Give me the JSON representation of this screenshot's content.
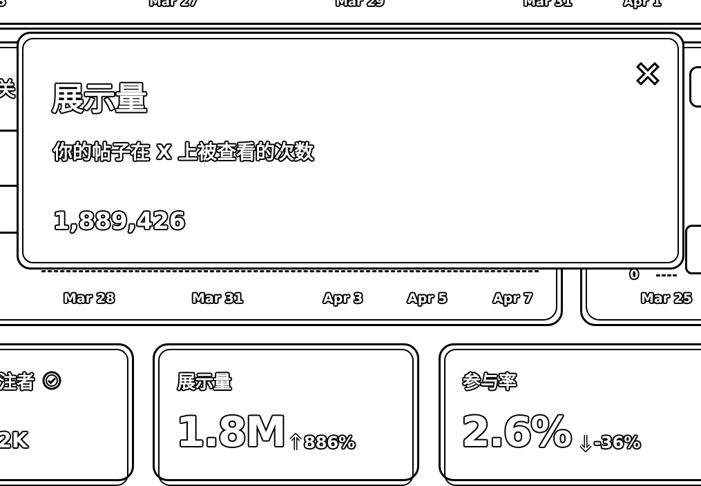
{
  "top_axis": {
    "labels": [
      "5",
      "Mar 27",
      "Mar 29",
      "Mar 31",
      "Apr 1"
    ]
  },
  "left_chart": {
    "x_labels": [
      "Mar 28",
      "Mar 31",
      "Apr 3",
      "Apr 5",
      "Apr 7"
    ]
  },
  "right_chart": {
    "y_zero": "0",
    "x_labels": [
      "Mar 25"
    ]
  },
  "left_fragment": "关",
  "tooltip": {
    "title": "展示量",
    "description": "你的帖子在 X 上被查看的次数",
    "value": "1,889,426",
    "close_icon": "close-icon"
  },
  "cards": {
    "followers": {
      "label": "注者",
      "value": "2K",
      "icon": "verified-badge-icon"
    },
    "impressions": {
      "label": "展示量",
      "value": "1.8M",
      "change": "886%",
      "change_icon": "arrow-up-icon"
    },
    "engagement": {
      "label": "参与率",
      "value": "2.6%",
      "change": "-36%",
      "change_icon": "arrow-down-icon"
    }
  }
}
